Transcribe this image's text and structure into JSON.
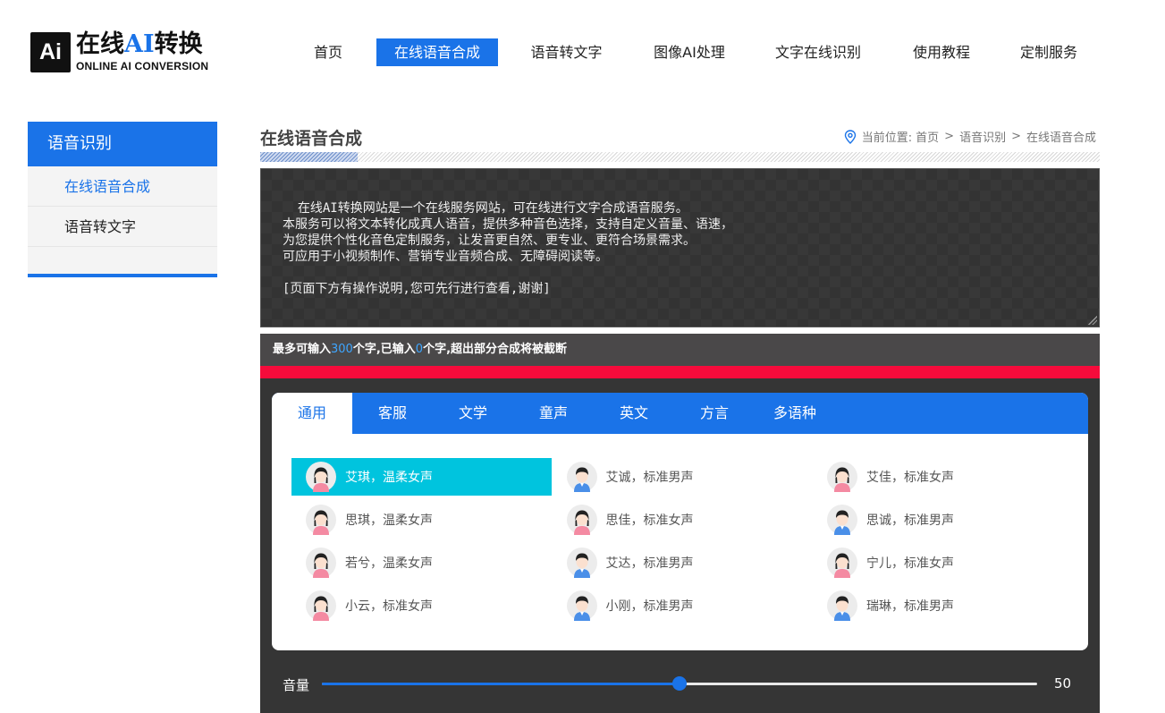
{
  "logo": {
    "icon_text": "Ai",
    "title_part1": "在线",
    "title_ai": "AI",
    "title_part2": "转换",
    "subtitle": "ONLINE AI CONVERSION"
  },
  "nav": [
    {
      "label": "首页",
      "active": false
    },
    {
      "label": "在线语音合成",
      "active": true
    },
    {
      "label": "语音转文字",
      "active": false
    },
    {
      "label": "图像AI处理",
      "active": false
    },
    {
      "label": "文字在线识别",
      "active": false
    },
    {
      "label": "使用教程",
      "active": false
    },
    {
      "label": "定制服务",
      "active": false
    }
  ],
  "sidebar": {
    "heading": "语音识别",
    "items": [
      {
        "label": "在线语音合成",
        "active": true
      },
      {
        "label": "语音转文字",
        "active": false
      }
    ]
  },
  "page": {
    "title": "在线语音合成",
    "breadcrumb": {
      "prefix": "当前位置:",
      "items": [
        "首页",
        "语音识别",
        "在线语音合成"
      ],
      "separator": ">"
    },
    "pin_icon": "location-pin-icon"
  },
  "textarea": {
    "content": "在线AI转换网站是一个在线服务网站，可在线进行文字合成语音服务。\n本服务可以将文本转化成真人语音，提供多种音色选择，支持自定义音量、语速，\n为您提供个性化音色定制服务，让发音更自然、更专业、更符合场景需求。\n可应用于小视频制作、营销专业音频合成、无障碍阅读等。\n\n[页面下方有操作说明,您可先行进行查看,谢谢]"
  },
  "char_limit": {
    "text1": "最多可输入",
    "max": "300",
    "text2": "个字,已输入",
    "count": "0",
    "text3": "个字,超出部分合成将被截断"
  },
  "tabs": [
    {
      "label": "通用",
      "active": true
    },
    {
      "label": "客服",
      "active": false
    },
    {
      "label": "文学",
      "active": false
    },
    {
      "label": "童声",
      "active": false
    },
    {
      "label": "英文",
      "active": false
    },
    {
      "label": "方言",
      "active": false
    },
    {
      "label": "多语种",
      "active": false
    }
  ],
  "voices": [
    {
      "label": "艾琪，温柔女声",
      "gender": "female",
      "active": true
    },
    {
      "label": "艾诚，标准男声",
      "gender": "male",
      "active": false
    },
    {
      "label": "艾佳，标准女声",
      "gender": "female",
      "active": false
    },
    {
      "label": "思琪，温柔女声",
      "gender": "female",
      "active": false
    },
    {
      "label": "思佳，标准女声",
      "gender": "female",
      "active": false
    },
    {
      "label": "思诚，标准男声",
      "gender": "male",
      "active": false
    },
    {
      "label": "若兮，温柔女声",
      "gender": "female",
      "active": false
    },
    {
      "label": "艾达，标准男声",
      "gender": "male",
      "active": false
    },
    {
      "label": "宁儿，标准女声",
      "gender": "female",
      "active": false
    },
    {
      "label": "小云，标准女声",
      "gender": "female",
      "active": false
    },
    {
      "label": "小刚，标准男声",
      "gender": "male",
      "active": false
    },
    {
      "label": "瑞琳，标准男声",
      "gender": "male",
      "active": false
    }
  ],
  "volume": {
    "label": "音量",
    "value": "50",
    "fraction": 0.5
  },
  "colors": {
    "accent": "#1a73e8",
    "selected_voice": "#00c4de",
    "warning_bar": "#f60b3b",
    "panel": "#353535"
  }
}
